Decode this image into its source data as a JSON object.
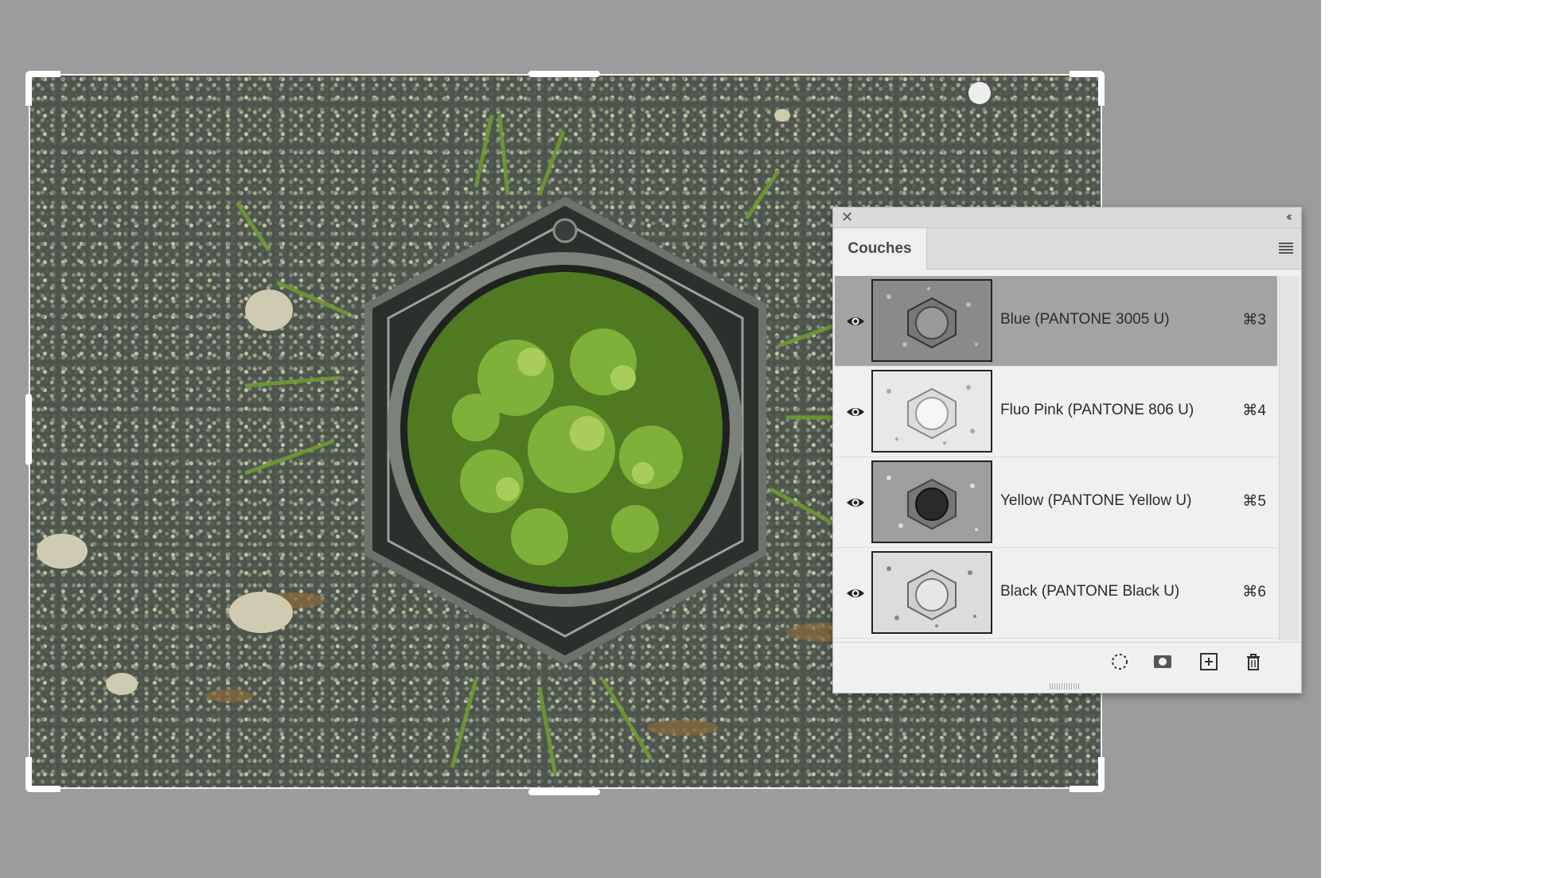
{
  "panel": {
    "tab_label": "Couches",
    "close_icon": "close-icon",
    "collapse_icon": "double-chevron-left-icon",
    "menu_icon": "panel-menu-icon"
  },
  "channels": [
    {
      "name": "Blue (PANTONE 3005 U)",
      "shortcut": "⌘3",
      "selected": true,
      "visible": true
    },
    {
      "name": "Fluo Pink (PANTONE 806 U)",
      "shortcut": "⌘4",
      "selected": false,
      "visible": true
    },
    {
      "name": "Yellow (PANTONE Yellow U)",
      "shortcut": "⌘5",
      "selected": false,
      "visible": true
    },
    {
      "name": "Black (PANTONE Black U)",
      "shortcut": "⌘6",
      "selected": false,
      "visible": true
    }
  ],
  "footer_icons": [
    "load-selection-icon",
    "save-selection-icon",
    "new-channel-icon",
    "delete-channel-icon"
  ],
  "colors": {
    "workspace": "#9c9c9c",
    "panel_bg": "#f0f0f0",
    "selected_row": "#a3a3a3"
  }
}
